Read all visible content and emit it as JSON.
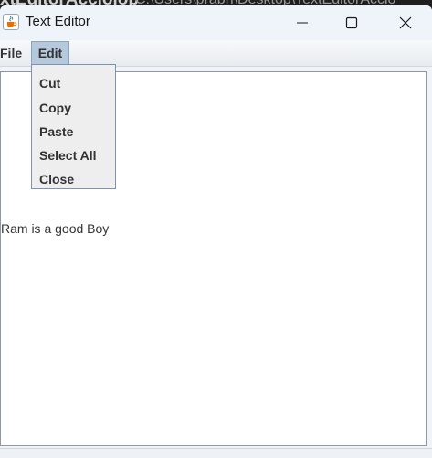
{
  "background_window": {
    "title": "xtEditorAcciolob",
    "path": "C:\\Users\\prabh\\Desktop\\TextEditorAccio"
  },
  "window": {
    "title": "Text Editor",
    "app_icon": "java-cup-icon",
    "controls": [
      "minimize-icon",
      "maximize-icon",
      "close-icon"
    ]
  },
  "menubar": {
    "file_label": "File",
    "edit_label": "Edit"
  },
  "edit_menu": {
    "items": [
      {
        "label": "Cut"
      },
      {
        "label": "Copy"
      },
      {
        "label": "Paste"
      },
      {
        "label": "Select All"
      },
      {
        "label": "Close"
      }
    ]
  },
  "editor": {
    "content": "Ram is a good Boy"
  },
  "colors": {
    "menu_highlight": "#b6c8dc",
    "dropdown_border": "#7f93b0",
    "titlebar": "#eff4fa"
  }
}
